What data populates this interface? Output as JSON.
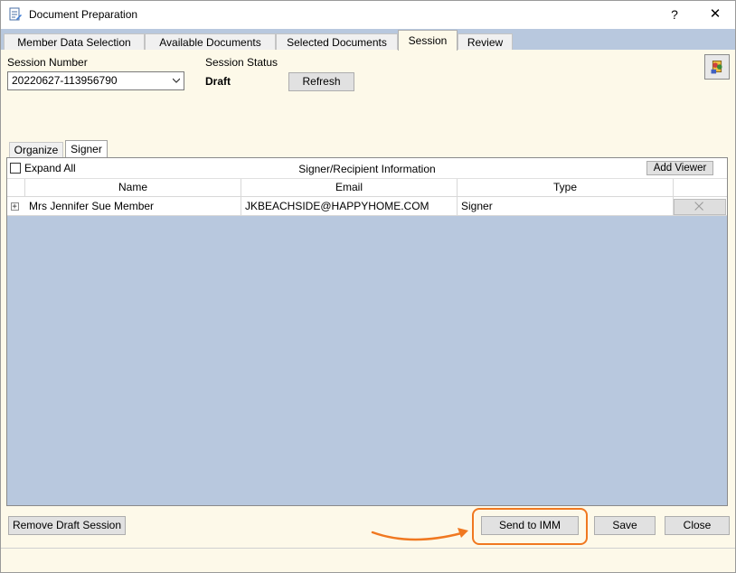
{
  "window": {
    "title": "Document Preparation",
    "help_label": "?",
    "close_label": "✕"
  },
  "tabs": [
    {
      "label": "Member Data Selection"
    },
    {
      "label": "Available Documents"
    },
    {
      "label": "Selected Documents"
    },
    {
      "label": "Session",
      "active": true
    },
    {
      "label": "Review"
    }
  ],
  "session": {
    "number_label": "Session Number",
    "number_value": "20220627-113956790",
    "status_label": "Session Status",
    "status_value": "Draft",
    "refresh_label": "Refresh"
  },
  "inner_tabs": [
    {
      "label": "Organize"
    },
    {
      "label": "Signer",
      "active": true
    }
  ],
  "grid": {
    "expand_all_label": "Expand All",
    "title": "Signer/Recipient Information",
    "add_viewer_label": "Add Viewer",
    "columns": [
      "Name",
      "Email",
      "Type"
    ],
    "rows": [
      {
        "name": "Mrs Jennifer Sue Member",
        "email": "JKBEACHSIDE@HAPPYHOME.COM",
        "type": "Signer"
      }
    ]
  },
  "footer_buttons": {
    "remove_draft": "Remove Draft Session",
    "send_to_imm": "Send to IMM",
    "save": "Save",
    "close": "Close"
  },
  "colors": {
    "panel_bg": "#fdf9e9",
    "tabstrip_bg": "#b8c8de",
    "highlight": "#f07820"
  }
}
